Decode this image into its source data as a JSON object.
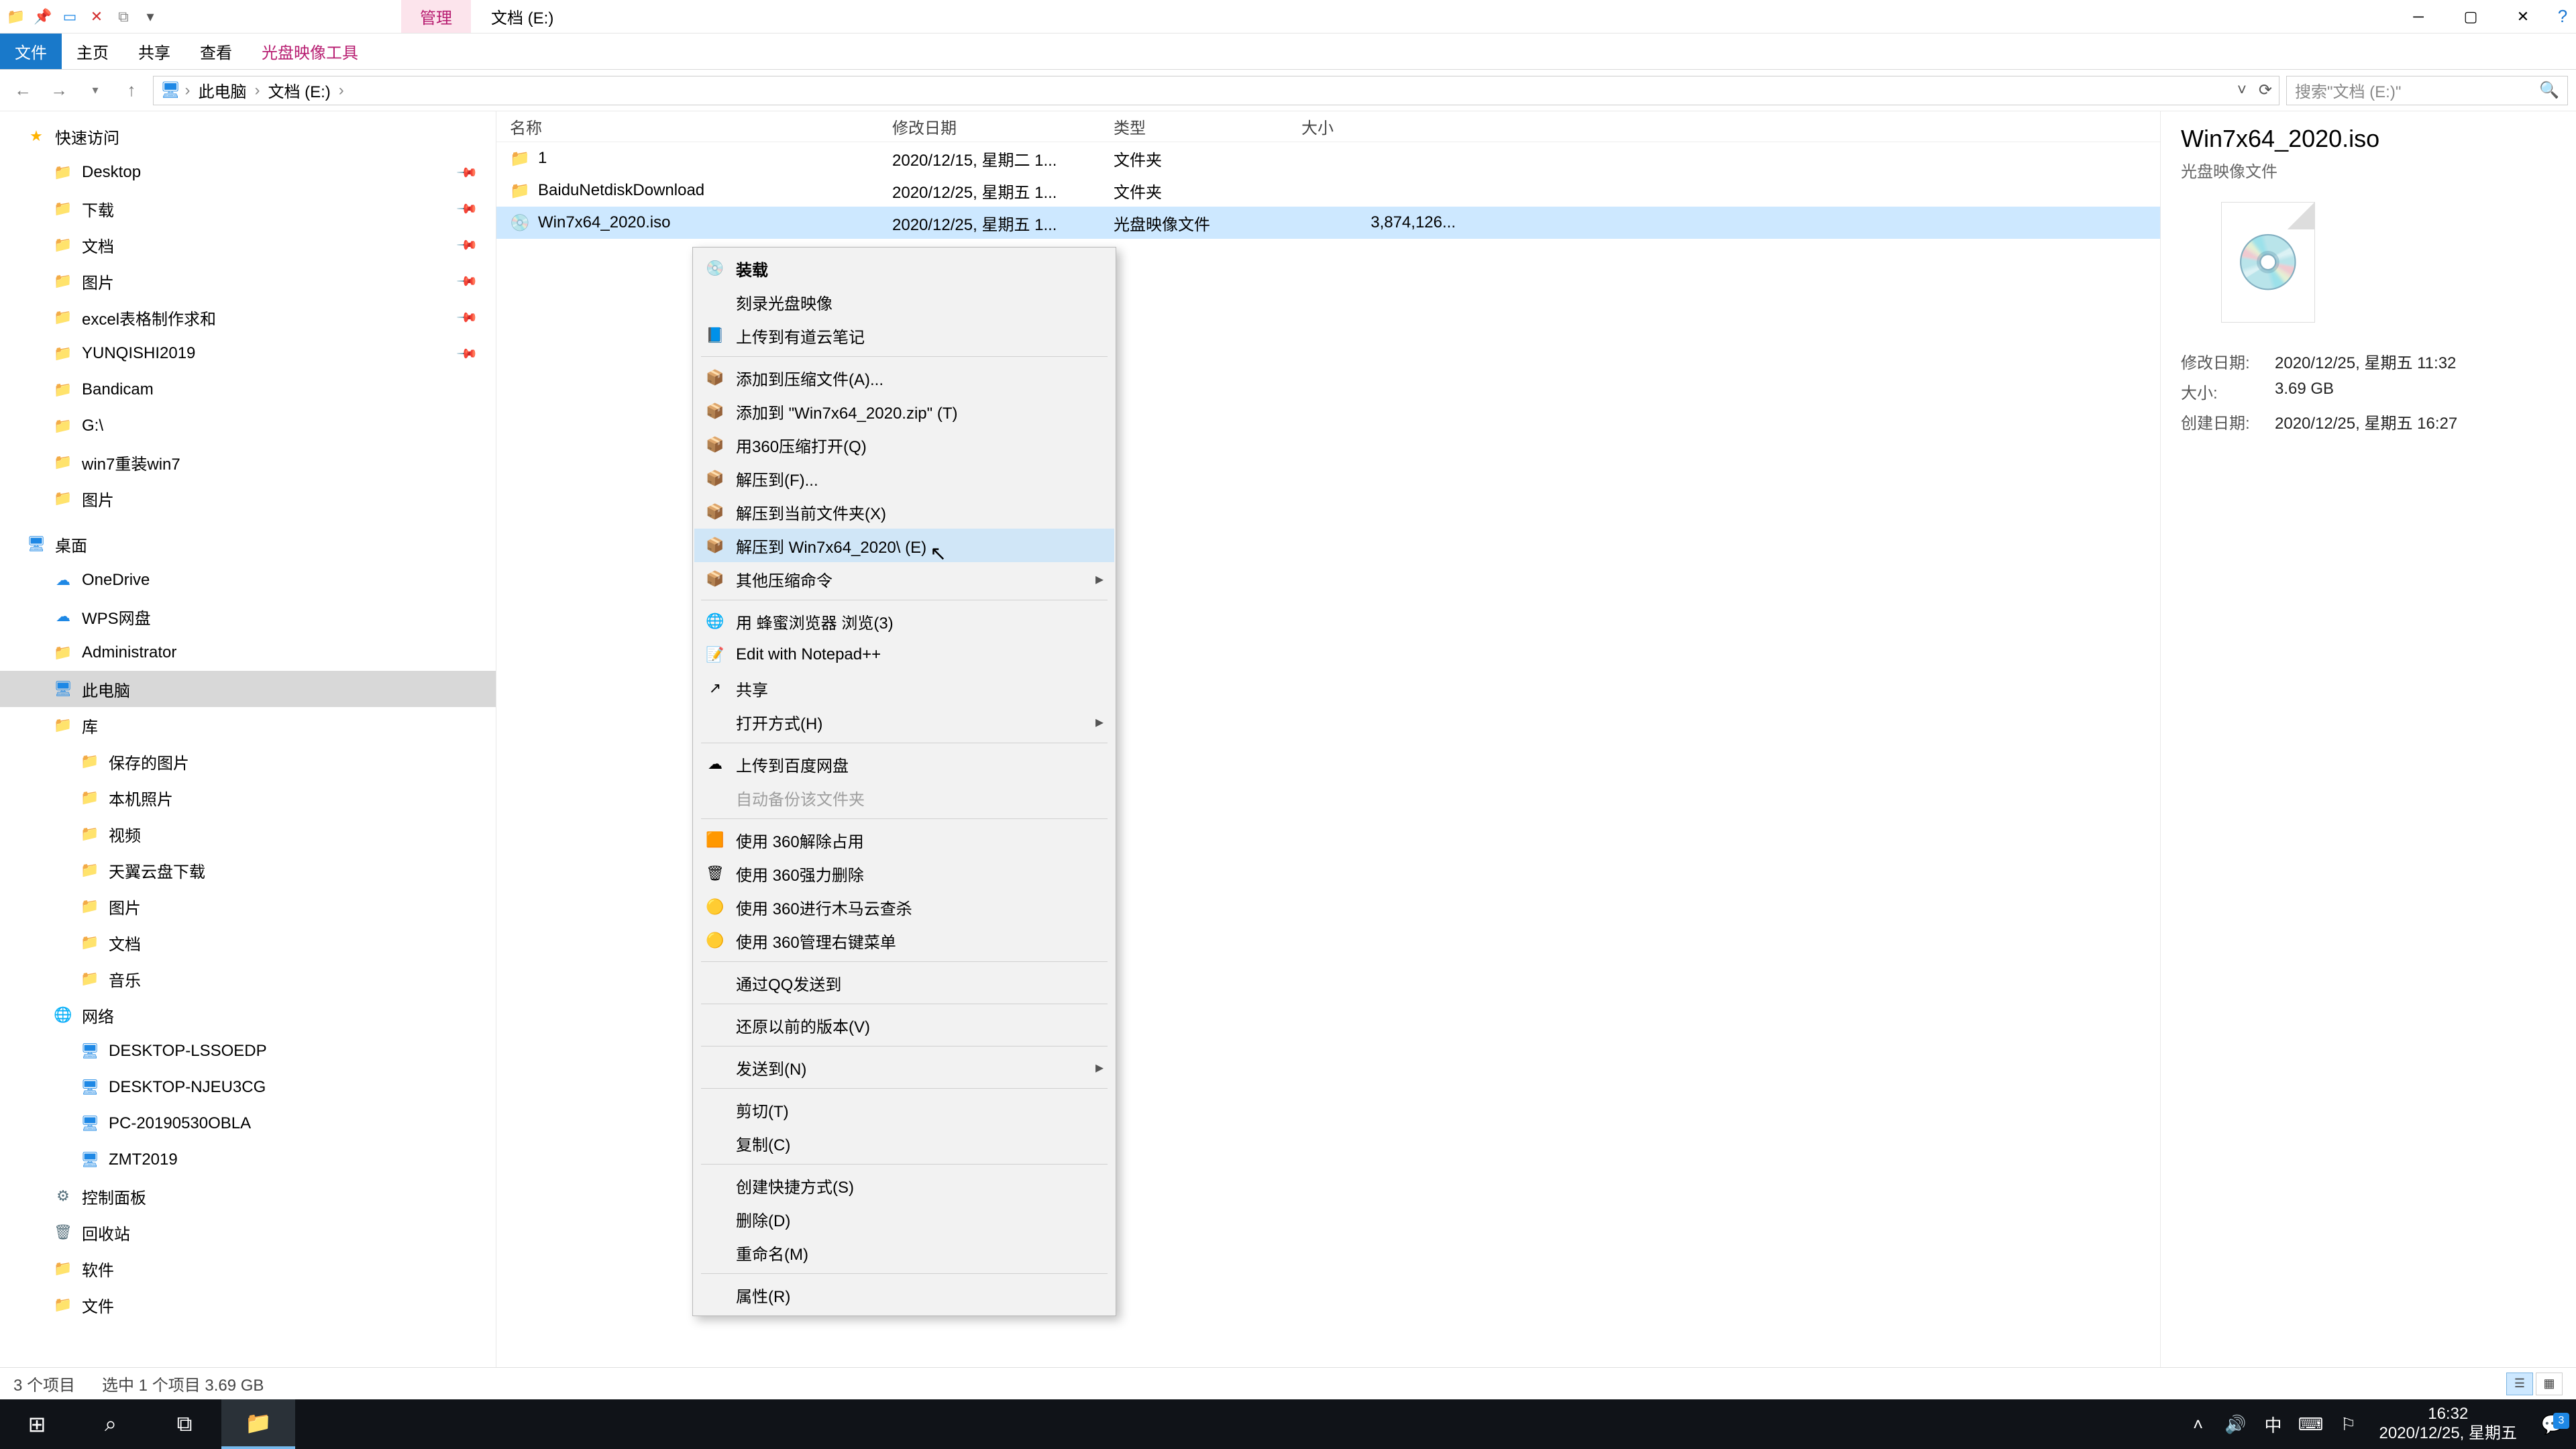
{
  "window": {
    "tab_manage": "管理",
    "title": "文档 (E:)"
  },
  "ribbon": {
    "file": "文件",
    "home": "主页",
    "share": "共享",
    "view": "查看",
    "disc": "光盘映像工具"
  },
  "address": {
    "crumbs": [
      "此电脑",
      "文档 (E:)"
    ],
    "search_placeholder": "搜索\"文档 (E:)\""
  },
  "tree": {
    "quick": "快速访问",
    "items_quick": [
      {
        "label": "Desktop",
        "icon": "ic-blue",
        "pin": true
      },
      {
        "label": "下载",
        "icon": "ic-dl",
        "pin": true
      },
      {
        "label": "文档",
        "icon": "ic-folder",
        "pin": true
      },
      {
        "label": "图片",
        "icon": "ic-folder",
        "pin": true
      },
      {
        "label": "excel表格制作求和",
        "icon": "ic-folder",
        "pin": true
      },
      {
        "label": "YUNQISHI2019",
        "icon": "ic-folder",
        "pin": true
      },
      {
        "label": "Bandicam",
        "icon": "ic-folder"
      },
      {
        "label": "G:\\",
        "icon": "ic-drive"
      },
      {
        "label": "win7重装win7",
        "icon": "ic-folder"
      },
      {
        "label": "图片",
        "icon": "ic-folder"
      }
    ],
    "desktop": "桌面",
    "items_desktop": [
      {
        "label": "OneDrive",
        "icon": "ic-blue"
      },
      {
        "label": "WPS网盘",
        "icon": "ic-blue"
      },
      {
        "label": "Administrator",
        "icon": "ic-folder"
      },
      {
        "label": "此电脑",
        "icon": "ic-monitor",
        "sel": true
      },
      {
        "label": "库",
        "icon": "ic-folder"
      }
    ],
    "items_lib": [
      {
        "label": "保存的图片"
      },
      {
        "label": "本机照片"
      },
      {
        "label": "视频"
      },
      {
        "label": "天翼云盘下载"
      },
      {
        "label": "图片"
      },
      {
        "label": "文档"
      },
      {
        "label": "音乐"
      }
    ],
    "network": "网络",
    "items_net": [
      {
        "label": "DESKTOP-LSSOEDP"
      },
      {
        "label": "DESKTOP-NJEU3CG"
      },
      {
        "label": "PC-20190530OBLA"
      },
      {
        "label": "ZMT2019"
      }
    ],
    "cpl": "控制面板",
    "recycle": "回收站",
    "soft": "软件",
    "wj": "文件"
  },
  "columns": {
    "name": "名称",
    "date": "修改日期",
    "type": "类型",
    "size": "大小"
  },
  "files": [
    {
      "name": "1",
      "date": "2020/12/15, 星期二 1...",
      "type": "文件夹",
      "size": "",
      "kind": "folder"
    },
    {
      "name": "BaiduNetdiskDownload",
      "date": "2020/12/25, 星期五 1...",
      "type": "文件夹",
      "size": "",
      "kind": "folder"
    },
    {
      "name": "Win7x64_2020.iso",
      "date": "2020/12/25, 星期五 1...",
      "type": "光盘映像文件",
      "size": "3,874,126...",
      "kind": "iso",
      "sel": true
    }
  ],
  "preview": {
    "title": "Win7x64_2020.iso",
    "subtitle": "光盘映像文件",
    "rows": [
      {
        "k": "修改日期:",
        "v": "2020/12/25, 星期五 11:32"
      },
      {
        "k": "大小:",
        "v": "3.69 GB"
      },
      {
        "k": "创建日期:",
        "v": "2020/12/25, 星期五 16:27"
      }
    ]
  },
  "ctx": {
    "groups": [
      [
        {
          "label": "装载",
          "icon": "💿",
          "bold": true
        },
        {
          "label": "刻录光盘映像"
        },
        {
          "label": "上传到有道云笔记",
          "icon": "📘"
        }
      ],
      [
        {
          "label": "添加到压缩文件(A)...",
          "icon": "📦"
        },
        {
          "label": "添加到 \"Win7x64_2020.zip\" (T)",
          "icon": "📦"
        },
        {
          "label": "用360压缩打开(Q)",
          "icon": "📦"
        },
        {
          "label": "解压到(F)...",
          "icon": "📦"
        },
        {
          "label": "解压到当前文件夹(X)",
          "icon": "📦"
        },
        {
          "label": "解压到 Win7x64_2020\\ (E)",
          "icon": "📦",
          "hov": true
        },
        {
          "label": "其他压缩命令",
          "icon": "📦",
          "sub": true
        }
      ],
      [
        {
          "label": "用 蜂蜜浏览器 浏览(3)",
          "icon": "🌐"
        },
        {
          "label": "Edit with Notepad++",
          "icon": "📝"
        },
        {
          "label": "共享",
          "icon": "↗"
        },
        {
          "label": "打开方式(H)",
          "sub": true
        }
      ],
      [
        {
          "label": "上传到百度网盘",
          "icon": "☁"
        },
        {
          "label": "自动备份该文件夹",
          "dis": true
        }
      ],
      [
        {
          "label": "使用 360解除占用",
          "icon": "🟧"
        },
        {
          "label": "使用 360强力删除",
          "icon": "🗑"
        },
        {
          "label": "使用 360进行木马云查杀",
          "icon": "🟡"
        },
        {
          "label": "使用 360管理右键菜单",
          "icon": "🟡"
        }
      ],
      [
        {
          "label": "通过QQ发送到"
        }
      ],
      [
        {
          "label": "还原以前的版本(V)"
        }
      ],
      [
        {
          "label": "发送到(N)",
          "sub": true
        }
      ],
      [
        {
          "label": "剪切(T)"
        },
        {
          "label": "复制(C)"
        }
      ],
      [
        {
          "label": "创建快捷方式(S)"
        },
        {
          "label": "删除(D)"
        },
        {
          "label": "重命名(M)"
        }
      ],
      [
        {
          "label": "属性(R)"
        }
      ]
    ]
  },
  "status": {
    "count": "3 个项目",
    "selected": "选中 1 个项目  3.69 GB"
  },
  "taskbar": {
    "ime": "中",
    "time": "16:32",
    "date": "2020/12/25, 星期五",
    "notif_badge": "3"
  }
}
